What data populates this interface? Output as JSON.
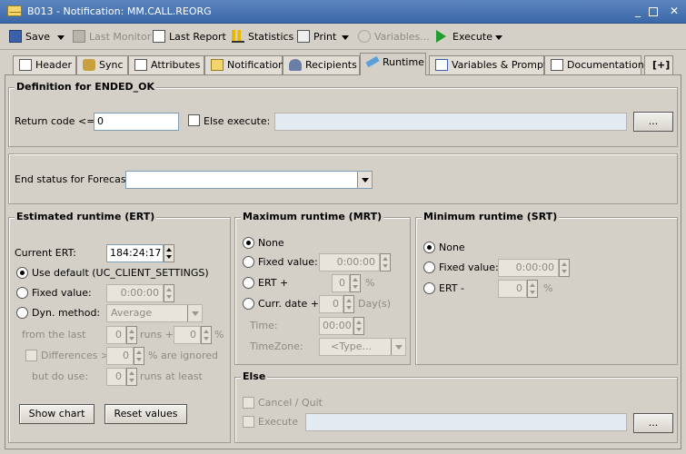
{
  "window": {
    "title": "B013 - Notification: MM.CALL.REORG"
  },
  "toolbar": {
    "save": "Save",
    "last_monitor": "Last Monitor",
    "last_report": "Last Report",
    "statistics": "Statistics",
    "print": "Print",
    "variables": "Variables...",
    "execute": "Execute"
  },
  "tabs": [
    "Header",
    "Sync",
    "Attributes",
    "Notification",
    "Recipients",
    "Runtime",
    "Variables & Prompts",
    "Documentation",
    "[+]"
  ],
  "definition": {
    "title": "Definition for ENDED_OK",
    "return_code_label": "Return code <=:",
    "return_code_value": "0",
    "else_execute_label": "Else execute:",
    "browse_label": "..."
  },
  "forecast": {
    "label": "End status for Forecast:"
  },
  "ert": {
    "title": "Estimated runtime (ERT)",
    "current_label": "Current ERT:",
    "current_value": "184:24:17",
    "use_default": "Use default (UC_CLIENT_SETTINGS)",
    "fixed_value_label": "Fixed value:",
    "fixed_value": "0:00:00",
    "dyn_method_label": "Dyn. method:",
    "dyn_method_value": "Average",
    "from_last_label": "from the last",
    "runs_value": "0",
    "runs_plus": "runs +",
    "percent_value": "0",
    "percent_sign": "%",
    "differences_label": "Differences >",
    "differences_value": "0",
    "are_ignored": "% are ignored",
    "but_do_use": "but do use:",
    "at_least_value": "0",
    "runs_at_least": "runs at least",
    "show_chart": "Show chart",
    "reset_values": "Reset values"
  },
  "mrt": {
    "title": "Maximum runtime (MRT)",
    "none": "None",
    "fixed_value_label": "Fixed value:",
    "fixed_value": "0:00:00",
    "ert_plus": "ERT +",
    "ert_plus_value": "0",
    "percent_sign": "%",
    "curr_date_plus": "Curr. date +",
    "days_value": "0",
    "days_label": "Day(s)",
    "time_label": "Time:",
    "time_value": "00:00",
    "timezone_label": "TimeZone:",
    "timezone_value": "<Type..."
  },
  "srt": {
    "title": "Minimum runtime (SRT)",
    "none": "None",
    "fixed_value_label": "Fixed value:",
    "fixed_value": "0:00:00",
    "ert_minus": "ERT -",
    "ert_minus_value": "0",
    "percent_sign": "%"
  },
  "else_group": {
    "title": "Else",
    "cancel_quit": "Cancel / Quit",
    "execute": "Execute",
    "browse_label": "..."
  }
}
